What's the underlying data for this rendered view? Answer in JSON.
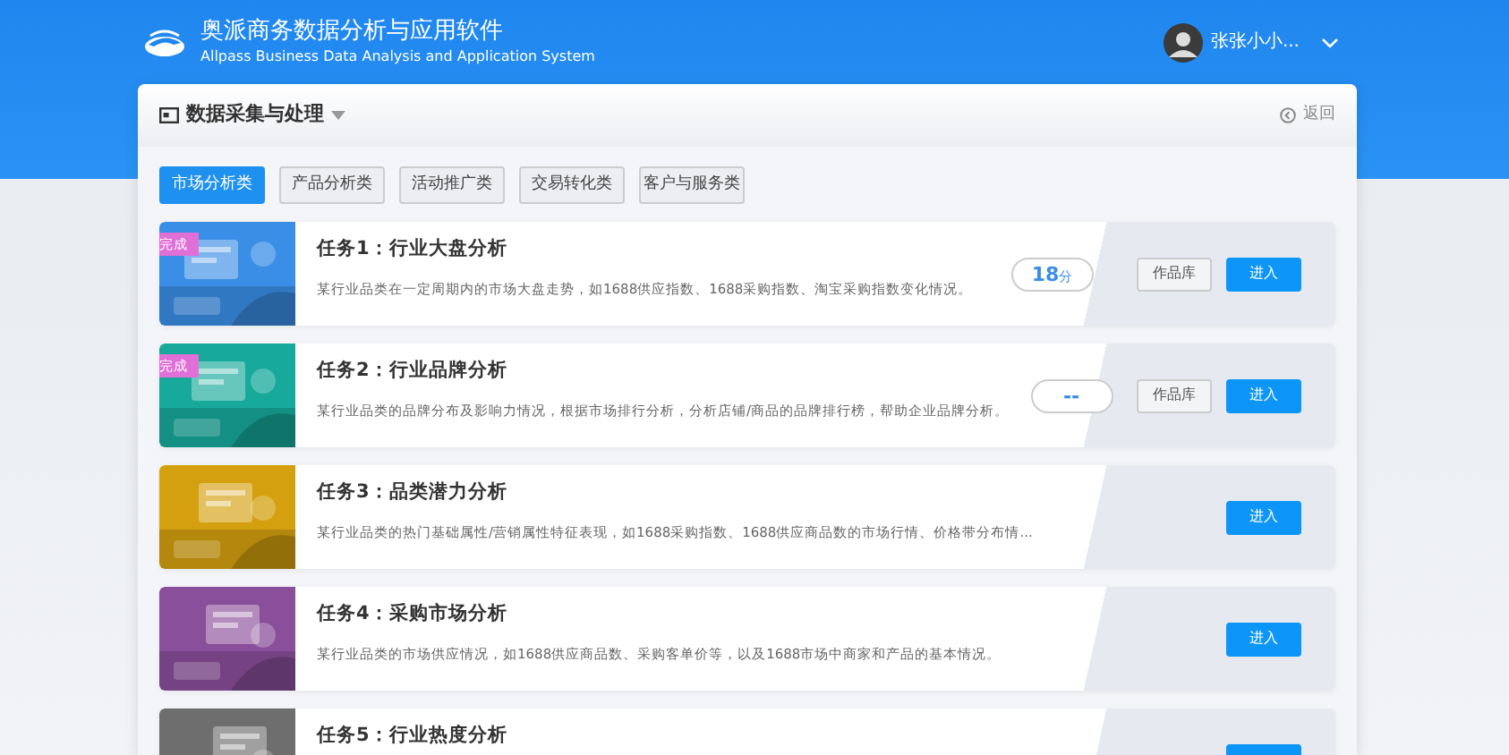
{
  "app": {
    "title": "奥派商务数据分析与应用软件",
    "subtitle": "Allpass Business Data Analysis and Application System"
  },
  "user": {
    "name": "张张小小..."
  },
  "panel": {
    "title": "数据采集与处理",
    "back": "返回"
  },
  "tabs": [
    {
      "label": "市场分析类",
      "selected": true
    },
    {
      "label": "产品分析类",
      "selected": false
    },
    {
      "label": "活动推广类",
      "selected": false
    },
    {
      "label": "交易转化类",
      "selected": false
    },
    {
      "label": "客户与服务类",
      "selected": false
    }
  ],
  "tasks": [
    {
      "title": "任务1：行业大盘分析",
      "description": "某行业品类在一定周期内的市场大盘走势，如1688供应指数、1688采购指数、淘宝采购指数变化情况。",
      "done": true,
      "done_label": "完成",
      "color": "#3a8ee6",
      "score": "18",
      "score_unit": "分",
      "works": "作品库",
      "enter": "进入"
    },
    {
      "title": "任务2：行业品牌分析",
      "description": "某行业品类的品牌分布及影响力情况，根据市场排行分析，分析店铺/商品的品牌排行榜，帮助企业品牌分析。",
      "done": true,
      "done_label": "完成",
      "color": "#17a99a",
      "score": "--",
      "works": "作品库",
      "enter": "进入"
    },
    {
      "title": "任务3：品类潜力分析",
      "description": "某行业品类的热门基础属性/营销属性特征表现，如1688采购指数、1688供应商品数的市场行情、价格带分布情...",
      "done": false,
      "color": "#d4a010",
      "enter": "进入"
    },
    {
      "title": "任务4：采购市场分析",
      "description": "某行业品类的市场供应情况，如1688供应商品数、采购客单价等，以及1688市场中商家和产品的基本情况。",
      "done": false,
      "color": "#8a4f9a",
      "enter": "进入"
    },
    {
      "title": "任务5：行业热度分析",
      "done": false,
      "color": "#6e6e6e"
    }
  ]
}
